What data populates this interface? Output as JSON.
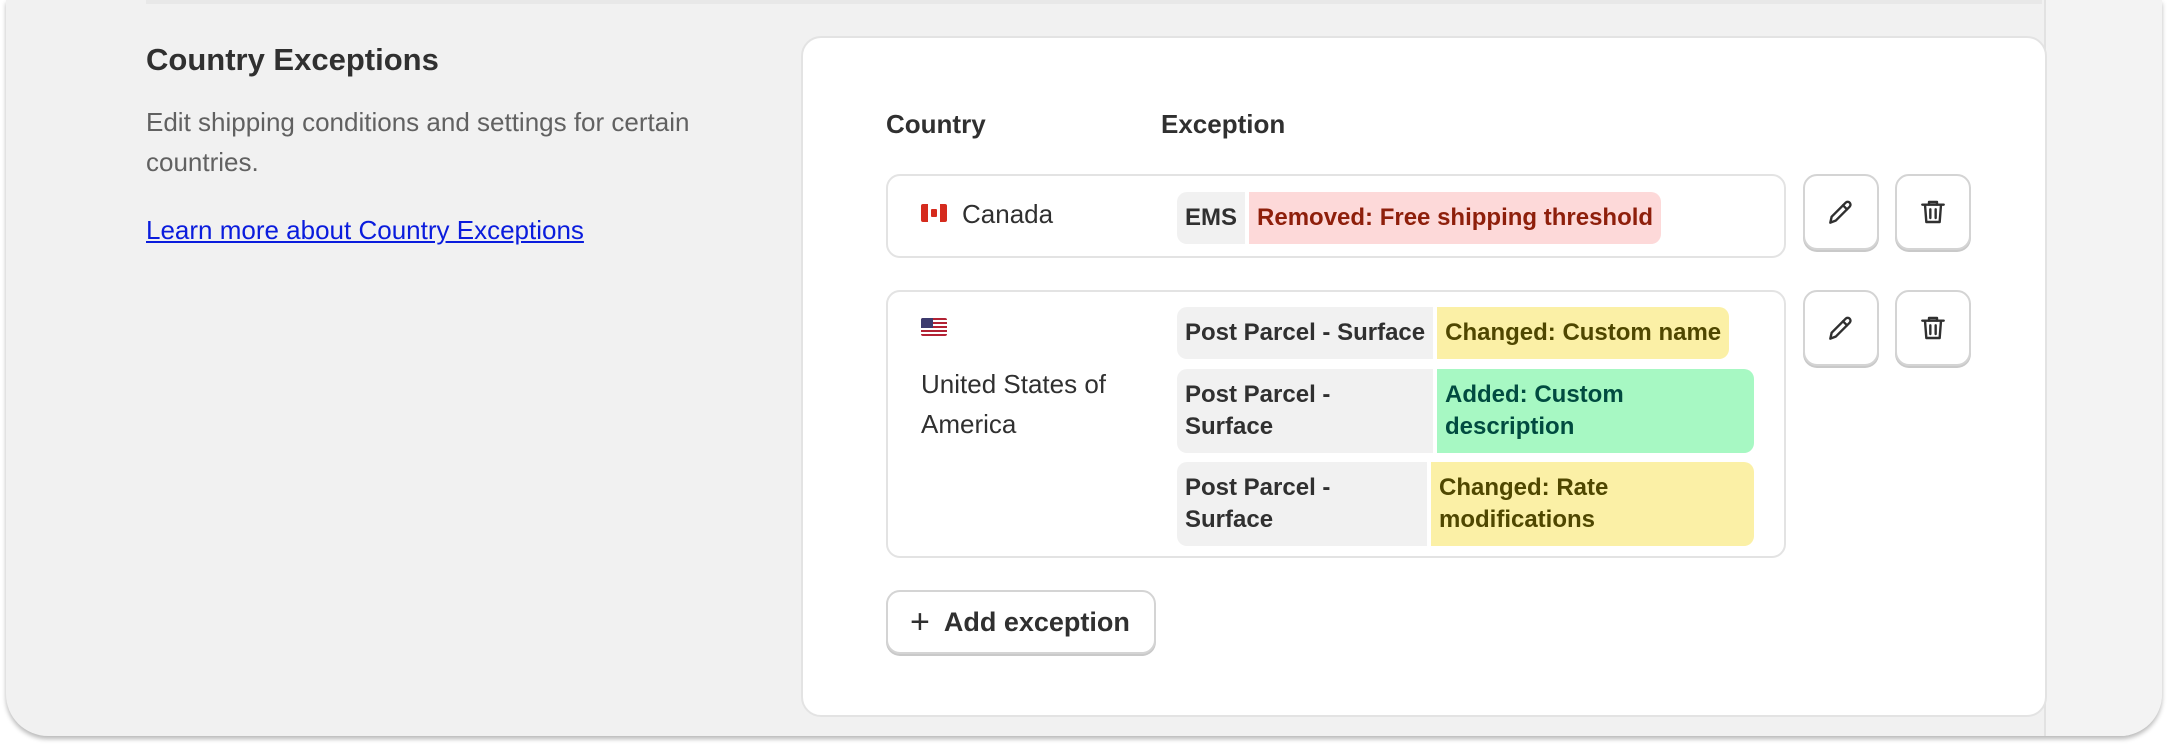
{
  "section": {
    "title": "Country Exceptions",
    "description": "Edit shipping conditions and settings for certain countries.",
    "learn_more_link": "Learn more about Country Exceptions"
  },
  "table": {
    "country_header": "Country",
    "exception_header": "Exception"
  },
  "rows": [
    {
      "country": "Canada",
      "flag_icon": "canada-flag-icon",
      "exceptions": [
        {
          "service": "EMS",
          "change": "Removed: Free shipping threshold",
          "kind": "removed"
        }
      ]
    },
    {
      "country": "United States of America",
      "flag_icon": "us-flag-icon",
      "exceptions": [
        {
          "service": "Post Parcel - Surface",
          "change": "Changed: Custom name",
          "kind": "changed"
        },
        {
          "service": "Post Parcel - Surface",
          "change": "Added: Custom description",
          "kind": "added"
        },
        {
          "service": "Post Parcel - Surface",
          "change": "Changed: Rate modifications",
          "kind": "changed"
        }
      ]
    }
  ],
  "actions": {
    "edit_icon": "pencil-icon",
    "delete_icon": "trash-icon",
    "add_label": "Add exception",
    "add_icon": "plus-icon"
  },
  "colors": {
    "removed_bg": "#fdd9d9",
    "changed_bg": "#fbf0a6",
    "added_bg": "#a7f8c3",
    "link": "#0a1cdd"
  }
}
